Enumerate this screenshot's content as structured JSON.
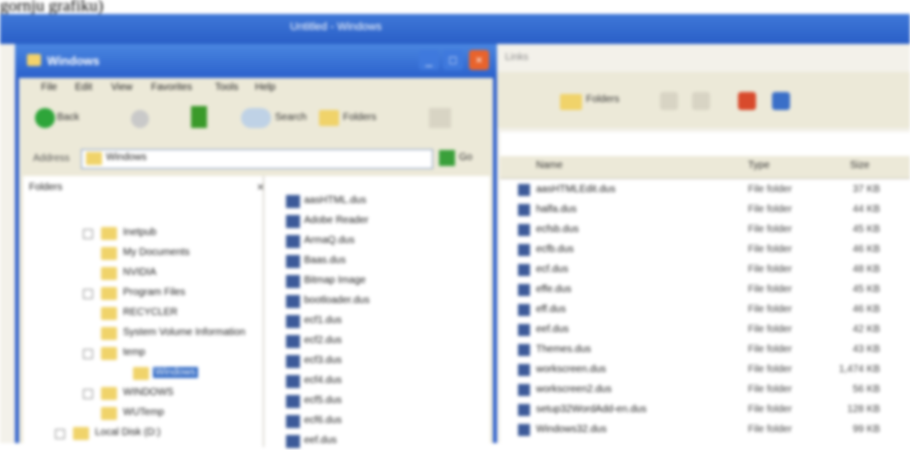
{
  "caption": "gornju grafiku)",
  "background_window": {
    "title": "Untitled - Windows",
    "address_tab": "Links",
    "toolbar": {
      "folders_label": "Folders"
    },
    "columns": {
      "name": "Name",
      "type": "Type",
      "size": "Size"
    },
    "rows": [
      {
        "name": "aasHTMLEdit.dus",
        "type": "File folder",
        "size": "37 KB"
      },
      {
        "name": "halfa.dus",
        "type": "File folder",
        "size": "44 KB"
      },
      {
        "name": "ecfsb.dus",
        "type": "File folder",
        "size": "45 KB"
      },
      {
        "name": "ecfb.dus",
        "type": "File folder",
        "size": "46 KB"
      },
      {
        "name": "ecf.dus",
        "type": "File folder",
        "size": "48 KB"
      },
      {
        "name": "effe.dus",
        "type": "File folder",
        "size": "45 KB"
      },
      {
        "name": "eff.dus",
        "type": "File folder",
        "size": "46 KB"
      },
      {
        "name": "eef.dus",
        "type": "File folder",
        "size": "42 KB"
      },
      {
        "name": "Themes.dus",
        "type": "File folder",
        "size": "43 KB"
      },
      {
        "name": "workscreen.dus",
        "type": "File folder",
        "size": "1,474 KB"
      },
      {
        "name": "workscreen2.dus",
        "type": "File folder",
        "size": "56 KB"
      },
      {
        "name": "setup32WordAdd-en.dus",
        "type": "File folder",
        "size": "128 KB"
      },
      {
        "name": "Windows32.dus",
        "type": "File folder",
        "size": "99 KB"
      }
    ]
  },
  "explorer": {
    "title": "Windows",
    "menu": [
      "File",
      "Edit",
      "View",
      "Favorites",
      "Tools",
      "Help"
    ],
    "toolbar": {
      "back_label": "Back",
      "search_label": "Search",
      "folders_label": "Folders"
    },
    "address": {
      "label": "Address",
      "value": "Windows",
      "go_label": "Go"
    },
    "tree_header": "Folders",
    "tree_close": "×",
    "tree": [
      {
        "label": "Inetpub",
        "expander": true
      },
      {
        "label": "My Documents",
        "expander": false
      },
      {
        "label": "NVIDIA",
        "expander": false
      },
      {
        "label": "Program Files",
        "expander": true
      },
      {
        "label": "RECYCLER",
        "expander": false
      },
      {
        "label": "System Volume Information",
        "expander": false
      },
      {
        "label": "temp",
        "expander": true
      },
      {
        "label": "Windows",
        "expander": false,
        "selected": true
      },
      {
        "label": "WINDOWS",
        "expander": true
      },
      {
        "label": "WUTemp",
        "expander": false
      },
      {
        "label": "Local Disk (D:)",
        "expander": true
      }
    ],
    "files": [
      "aasHTML.dus",
      "Adobe Reader",
      "ArmaQ.dus",
      "Baas.dus",
      "Bitmap Image",
      "bootloader.dus",
      "ecf1.dus",
      "ecf2.dus",
      "ecf3.dus",
      "ecf4.dus",
      "ecf5.dus",
      "ecf6.dus",
      "eef.dus"
    ]
  },
  "colors": {
    "xp_blue": "#2b61cc",
    "selection": "#316ac5",
    "face": "#ece9d8",
    "folder": "#f0d36a",
    "close_red": "#e8632c"
  }
}
